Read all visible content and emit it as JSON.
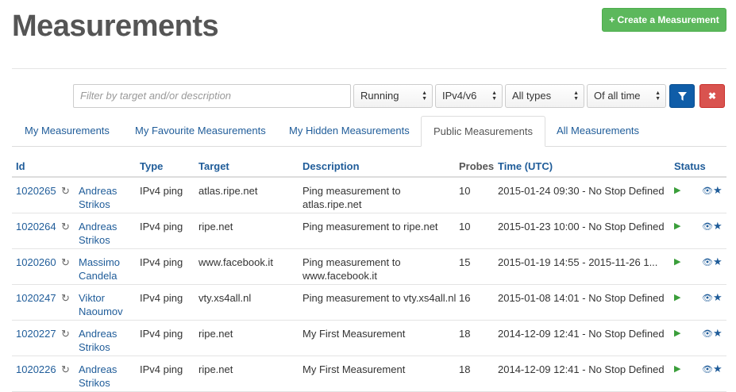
{
  "page": {
    "title": "Measurements"
  },
  "toolbar": {
    "create_label": "+ Create a Measurement"
  },
  "filters": {
    "search_placeholder": "Filter by target and/or description",
    "status": "Running",
    "af": "IPv4/v6",
    "type": "All types",
    "time": "Of all time"
  },
  "tabs": [
    {
      "label": "My Measurements",
      "active": false
    },
    {
      "label": "My Favourite Measurements",
      "active": false
    },
    {
      "label": "My Hidden Measurements",
      "active": false
    },
    {
      "label": "Public Measurements",
      "active": true
    },
    {
      "label": "All Measurements",
      "active": false
    }
  ],
  "table": {
    "headers": {
      "id": "Id",
      "type": "Type",
      "target": "Target",
      "description": "Description",
      "probes": "Probes",
      "time": "Time (UTC)",
      "status": "Status"
    },
    "rows": [
      {
        "id": "1020265",
        "owner": "Andreas Strikos",
        "type": "IPv4 ping",
        "target": "atlas.ripe.net",
        "description": "Ping measurement to atlas.ripe.net",
        "probes": "10",
        "time": "2015-01-24 09:30 - No Stop Defined"
      },
      {
        "id": "1020264",
        "owner": "Andreas Strikos",
        "type": "IPv4 ping",
        "target": "ripe.net",
        "description": "Ping measurement to ripe.net",
        "probes": "10",
        "time": "2015-01-23 10:00 - No Stop Defined"
      },
      {
        "id": "1020260",
        "owner": "Massimo Candela",
        "type": "IPv4 ping",
        "target": "www.facebook.it",
        "description": "Ping measurement to www.facebook.it",
        "probes": "15",
        "time": "2015-01-19 14:55 - 2015-11-26 1..."
      },
      {
        "id": "1020247",
        "owner": "Viktor Naoumov",
        "type": "IPv4 ping",
        "target": "vty.xs4all.nl",
        "description": "Ping measurement to vty.xs4all.nl",
        "probes": "16",
        "time": "2015-01-08 14:01 - No Stop Defined"
      },
      {
        "id": "1020227",
        "owner": "Andreas Strikos",
        "type": "IPv4 ping",
        "target": "ripe.net",
        "description": "My First Measurement",
        "probes": "18",
        "time": "2014-12-09 12:41 - No Stop Defined"
      },
      {
        "id": "1020226",
        "owner": "Andreas Strikos",
        "type": "IPv4 ping",
        "target": "ripe.net",
        "description": "My First Measurement",
        "probes": "18",
        "time": "2014-12-09 12:41 - No Stop Defined"
      }
    ]
  },
  "icons": {
    "refresh": "refresh-icon",
    "status": "play-icon",
    "view": "eye-icon",
    "favourite": "star-icon"
  },
  "colors": {
    "accent": "#1f5c99",
    "create": "#5cb85c",
    "filter": "#0f5da8",
    "clear": "#d9534f",
    "running": "#3a9e3a"
  }
}
